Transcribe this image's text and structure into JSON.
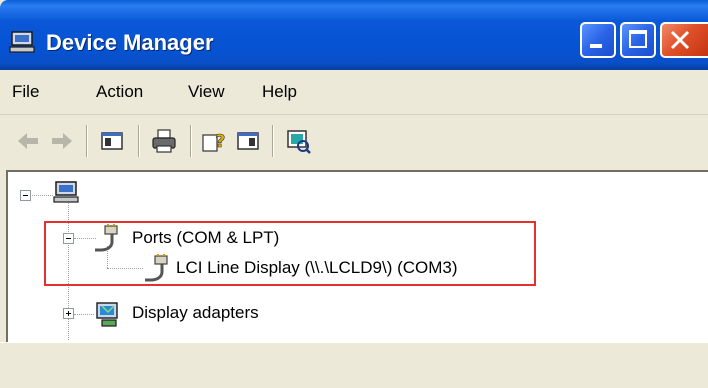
{
  "window": {
    "title": "Device Manager"
  },
  "menu": {
    "file": "File",
    "action": "Action",
    "view": "View",
    "help": "Help"
  },
  "tree": {
    "ports_label": "Ports (COM & LPT)",
    "lci_label": "LCI Line Display (\\\\.\\LCLD9\\) (COM3)",
    "display_label": "Display adapters"
  },
  "colors": {
    "titlebar": "#0553d2",
    "highlight": "#e53030",
    "chrome": "#ece9d8"
  }
}
